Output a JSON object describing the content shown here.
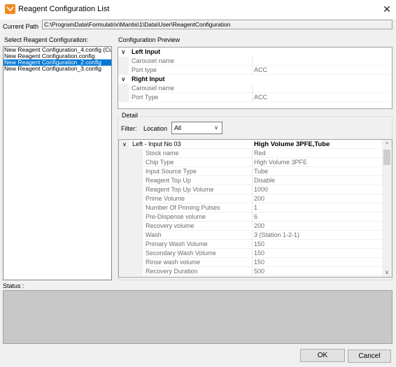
{
  "window": {
    "title": "Reagent Configuration List",
    "close_glyph": "✕"
  },
  "path": {
    "label": "Current Path",
    "value": "C:\\ProgramData\\Formulatrix\\Mantis\\1\\Data\\User\\ReagentConfiguration"
  },
  "config_list": {
    "label": "Select Reagent Configuration:",
    "items": [
      "New Reagent Configuration_4.config (Cu",
      "New Reagent Configuration.config",
      "New Reagent Configuration_2.config",
      "New Reagent Configuration_3.config"
    ],
    "selected_index": 2
  },
  "preview": {
    "label": "Configuration Preview",
    "chevron": "∨",
    "left_input": {
      "title": "Left Input",
      "rows": [
        {
          "name": "Carousel name",
          "value": ""
        },
        {
          "name": "Port type",
          "value": "ACC"
        }
      ]
    },
    "right_input": {
      "title": "Right Input",
      "rows": [
        {
          "name": "Carousel name",
          "value": ""
        },
        {
          "name": "Port Type",
          "value": "ACC"
        }
      ]
    }
  },
  "detail": {
    "label": "Detail",
    "filter_label": "Filter:",
    "location_label": "Location",
    "location_value": "All",
    "dropdown_glyph": "∨",
    "group_header": {
      "chevron": "∨",
      "name": "Left - Input No 03",
      "value": "High Volume 3PFE,Tube"
    },
    "rows": [
      {
        "name": "Stock name",
        "value": "Red"
      },
      {
        "name": "Chip Type",
        "value": "High Volume 3PFE"
      },
      {
        "name": "Input Source Type",
        "value": "Tube"
      },
      {
        "name": "Reagent Top Up",
        "value": "Disable"
      },
      {
        "name": "Reagent Top Up Volume",
        "value": "1000"
      },
      {
        "name": "Prime Volume",
        "value": "200"
      },
      {
        "name": "Number Of Priming Pulses",
        "value": "1"
      },
      {
        "name": "Pre-Dispense volume",
        "value": "6"
      },
      {
        "name": "Recovery volume",
        "value": "200"
      },
      {
        "name": "Wash",
        "value": "3 (Station 1-2-1)"
      },
      {
        "name": "Primary Wash Volume",
        "value": "150"
      },
      {
        "name": "Secondary Wash Volume",
        "value": "150"
      },
      {
        "name": "Rinse wash volume",
        "value": "150"
      },
      {
        "name": "Recovery Duration",
        "value": "500"
      }
    ],
    "scroll_up": "^",
    "scroll_down": "∨"
  },
  "status": {
    "label": "Status :"
  },
  "buttons": {
    "ok": "OK",
    "cancel": "Cancel"
  },
  "colors": {
    "accent_selected": "#0078d7",
    "app_icon": "#f08a24",
    "status_bg": "#c8c8c8"
  },
  "icons": {
    "app": "reagent-app-icon",
    "close": "close-icon"
  }
}
